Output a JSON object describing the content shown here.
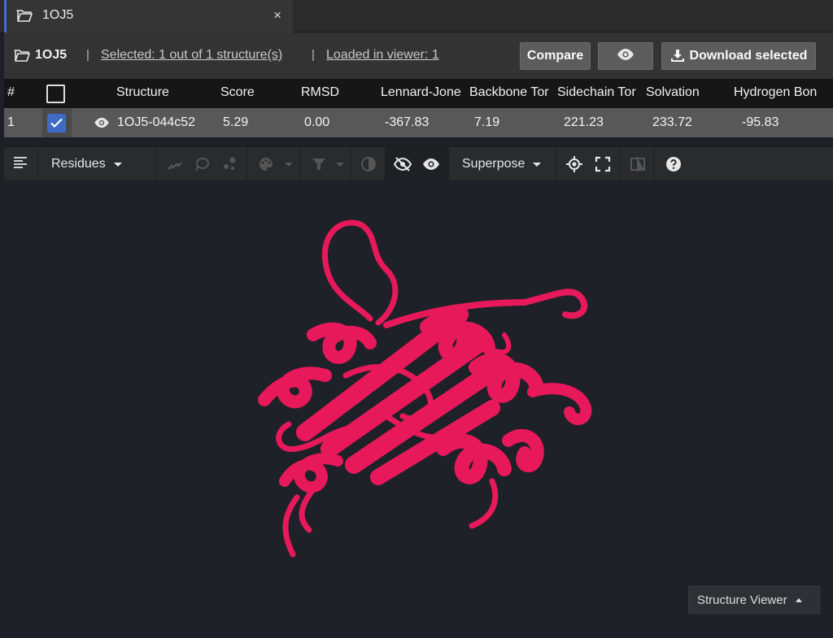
{
  "tab": {
    "title": "1OJ5",
    "close_glyph": "×"
  },
  "header": {
    "title": "1OJ5",
    "separator": "|",
    "selected_link": "Selected: 1 out of 1 structure(s)",
    "loaded_link": "Loaded in viewer: 1",
    "compare_label": "Compare",
    "download_label": "Download selected"
  },
  "table": {
    "columns": [
      "#",
      "Structure",
      "Score",
      "RMSD",
      "Lennard-Jone",
      "Backbone Tor",
      "Sidechain Tor",
      "Solvation",
      "Hydrogen Bon"
    ],
    "rows": [
      {
        "index": "1",
        "checked": true,
        "structure": "1OJ5-044c52",
        "score": "5.29",
        "rmsd": "0.00",
        "lennard_jones": "-367.83",
        "backbone_torsion": "7.19",
        "sidechain_torsion": "221.23",
        "solvation": "233.72",
        "hydrogen_bond": "-95.83"
      }
    ]
  },
  "toolbar": {
    "residues_label": "Residues",
    "superpose_label": "Superpose"
  },
  "viewer": {
    "panel_label": "Structure Viewer",
    "ribbon_color": "#e8195a",
    "background_color": "#1f2128"
  },
  "icons": [
    "folder-icon",
    "close-icon",
    "eye-icon",
    "download-icon",
    "checkbox-icon",
    "check-icon",
    "list-icon",
    "helix-icon",
    "lasso-icon",
    "molecule-icon",
    "palette-icon",
    "filter-icon",
    "contrast-icon",
    "eye-off-icon",
    "target-icon",
    "fullscreen-icon",
    "split-view-icon",
    "help-icon"
  ]
}
